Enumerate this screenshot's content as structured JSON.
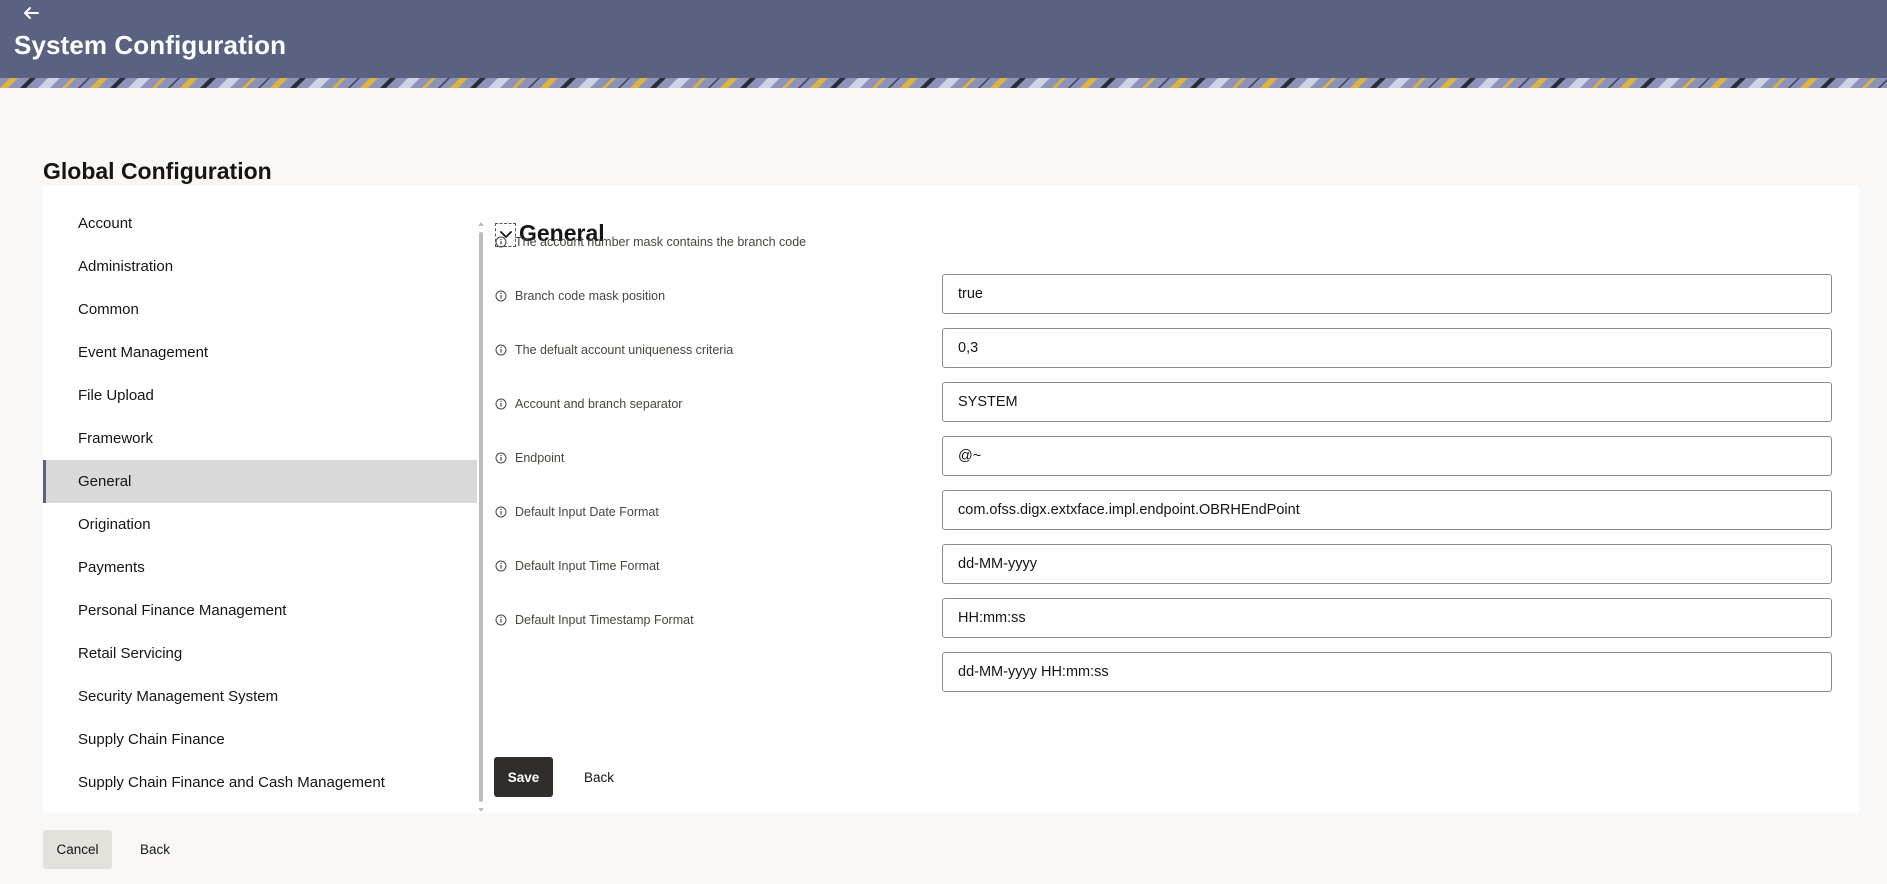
{
  "header": {
    "title": "System Configuration",
    "back_icon": "arrow-left-icon",
    "background_color": "#5b6180"
  },
  "section": {
    "title": "Global Configuration"
  },
  "sidebar": {
    "items": [
      {
        "label": "Account"
      },
      {
        "label": "Administration"
      },
      {
        "label": "Common"
      },
      {
        "label": "Event Management"
      },
      {
        "label": "File Upload"
      },
      {
        "label": "Framework"
      },
      {
        "label": "General",
        "active": true
      },
      {
        "label": "Origination"
      },
      {
        "label": "Payments"
      },
      {
        "label": "Personal Finance Management"
      },
      {
        "label": "Retail Servicing"
      },
      {
        "label": "Security Management System"
      },
      {
        "label": "Supply Chain Finance"
      },
      {
        "label": "Supply Chain Finance and Cash Management"
      }
    ]
  },
  "main": {
    "group_title": "General",
    "collapse_icon": "chevron-down-icon",
    "fields": [
      {
        "label": "The account number mask contains the branch code",
        "value": "true"
      },
      {
        "label": "Branch code mask position",
        "value": "0,3"
      },
      {
        "label": "The defualt account uniqueness criteria",
        "value": "SYSTEM"
      },
      {
        "label": "Account and branch separator",
        "value": "@~"
      },
      {
        "label": "Endpoint",
        "value": "com.ofss.digx.extxface.impl.endpoint.OBRHEndPoint"
      },
      {
        "label": "Default Input Date Format",
        "value": "dd-MM-yyyy"
      },
      {
        "label": "Default Input Time Format",
        "value": "HH:mm:ss"
      },
      {
        "label": "Default Input Timestamp Format",
        "value": "dd-MM-yyyy HH:mm:ss"
      }
    ],
    "save_label": "Save",
    "back_label": "Back"
  },
  "footer": {
    "cancel_label": "Cancel",
    "back_label": "Back"
  }
}
